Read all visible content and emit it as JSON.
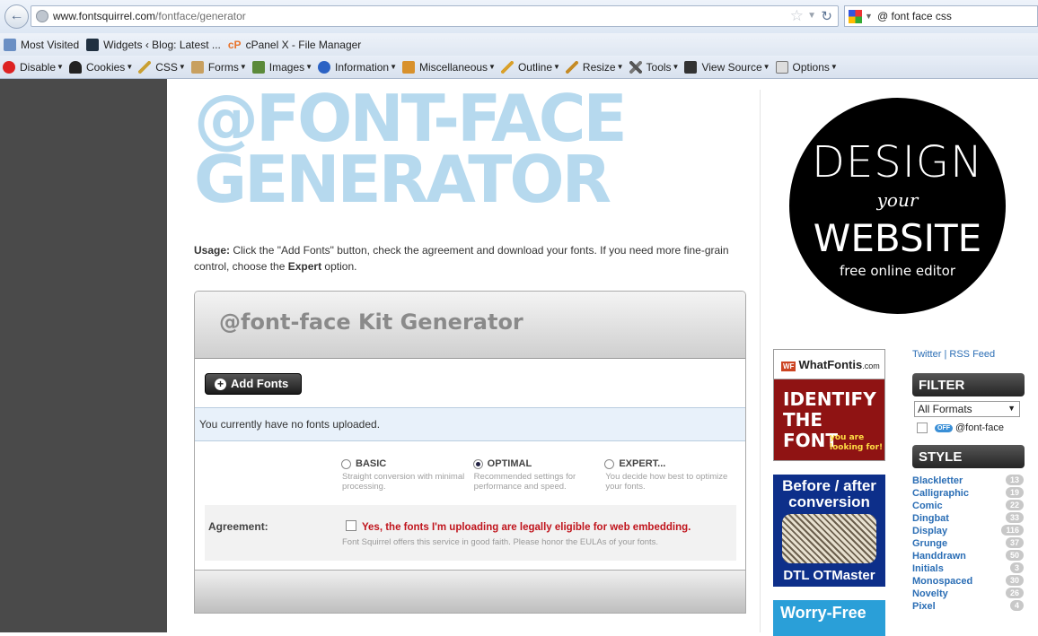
{
  "browser": {
    "url_domain": "www.fontsquirrel.com",
    "url_path": "/fontface/generator",
    "search_query": "@ font face css"
  },
  "bookmarks": [
    "Most Visited",
    "Widgets ‹ Blog: Latest ...",
    "cPanel X - File Manager"
  ],
  "webdev_toolbar": [
    "Disable",
    "Cookies",
    "CSS",
    "Forms",
    "Images",
    "Information",
    "Miscellaneous",
    "Outline",
    "Resize",
    "Tools",
    "View Source",
    "Options"
  ],
  "page": {
    "heading_line1": "@FONT-FACE",
    "heading_line2": "GENERATOR",
    "usage_label": "Usage:",
    "usage_text_1": " Click the \"Add Fonts\" button, check the agreement and download your fonts. If you need more fine-grain control, choose the ",
    "usage_expert": "Expert",
    "usage_text_2": " option.",
    "kit_title": "@font-face Kit Generator",
    "add_fonts_label": "Add Fonts",
    "no_fonts_text": "You currently have no fonts uploaded.",
    "modes": [
      {
        "label": "BASIC",
        "desc": "Straight conversion with minimal processing."
      },
      {
        "label": "OPTIMAL",
        "desc": "Recommended settings for performance and speed."
      },
      {
        "label": "EXPERT...",
        "desc": "You decide how best to optimize your fonts."
      }
    ],
    "agreement_label": "Agreement:",
    "agreement_text": "Yes, the fonts I'm uploading are legally eligible for web embedding.",
    "agreement_sub": "Font Squirrel offers this service in good faith. Please honor the EULAs of your fonts."
  },
  "promo": {
    "line1": "DESIGN",
    "line2": "your",
    "line3": "WEBSITE",
    "line4": "free online editor"
  },
  "ads": {
    "ad1_brand": "WhatFontis",
    "ad1_brand_suffix": ".com",
    "ad1_badge": "WF",
    "ad1_text1": "IDENTIFY",
    "ad1_text2": "THE",
    "ad1_text3": "FONT",
    "ad1_small": "you are looking for!",
    "ad2_title": "Before / after conversion",
    "ad2_brand": "DTL OTMaster",
    "ad3_title": "Worry-Free"
  },
  "sidebar": {
    "twitter": "Twitter",
    "rss": "RSS Feed",
    "filter_title": "FILTER",
    "filter_select": "All Formats",
    "off_tag": "OFF",
    "fontface_label": "@font-face",
    "style_title": "STYLE",
    "styles": [
      {
        "name": "Blackletter",
        "count": "13"
      },
      {
        "name": "Calligraphic",
        "count": "19"
      },
      {
        "name": "Comic",
        "count": "22"
      },
      {
        "name": "Dingbat",
        "count": "33"
      },
      {
        "name": "Display",
        "count": "116"
      },
      {
        "name": "Grunge",
        "count": "37"
      },
      {
        "name": "Handdrawn",
        "count": "50"
      },
      {
        "name": "Initials",
        "count": "3"
      },
      {
        "name": "Monospaced",
        "count": "30"
      },
      {
        "name": "Novelty",
        "count": "26"
      },
      {
        "name": "Pixel",
        "count": "4"
      }
    ]
  }
}
